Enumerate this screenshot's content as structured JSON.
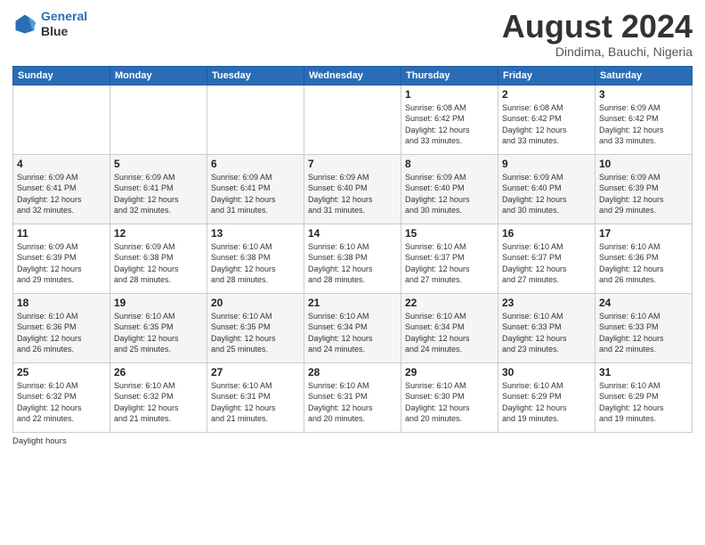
{
  "header": {
    "logo_line1": "General",
    "logo_line2": "Blue",
    "month_title": "August 2024",
    "location": "Dindima, Bauchi, Nigeria"
  },
  "days_of_week": [
    "Sunday",
    "Monday",
    "Tuesday",
    "Wednesday",
    "Thursday",
    "Friday",
    "Saturday"
  ],
  "weeks": [
    [
      {
        "day": "",
        "info": ""
      },
      {
        "day": "",
        "info": ""
      },
      {
        "day": "",
        "info": ""
      },
      {
        "day": "",
        "info": ""
      },
      {
        "day": "1",
        "info": "Sunrise: 6:08 AM\nSunset: 6:42 PM\nDaylight: 12 hours\nand 33 minutes."
      },
      {
        "day": "2",
        "info": "Sunrise: 6:08 AM\nSunset: 6:42 PM\nDaylight: 12 hours\nand 33 minutes."
      },
      {
        "day": "3",
        "info": "Sunrise: 6:09 AM\nSunset: 6:42 PM\nDaylight: 12 hours\nand 33 minutes."
      }
    ],
    [
      {
        "day": "4",
        "info": "Sunrise: 6:09 AM\nSunset: 6:41 PM\nDaylight: 12 hours\nand 32 minutes."
      },
      {
        "day": "5",
        "info": "Sunrise: 6:09 AM\nSunset: 6:41 PM\nDaylight: 12 hours\nand 32 minutes."
      },
      {
        "day": "6",
        "info": "Sunrise: 6:09 AM\nSunset: 6:41 PM\nDaylight: 12 hours\nand 31 minutes."
      },
      {
        "day": "7",
        "info": "Sunrise: 6:09 AM\nSunset: 6:40 PM\nDaylight: 12 hours\nand 31 minutes."
      },
      {
        "day": "8",
        "info": "Sunrise: 6:09 AM\nSunset: 6:40 PM\nDaylight: 12 hours\nand 30 minutes."
      },
      {
        "day": "9",
        "info": "Sunrise: 6:09 AM\nSunset: 6:40 PM\nDaylight: 12 hours\nand 30 minutes."
      },
      {
        "day": "10",
        "info": "Sunrise: 6:09 AM\nSunset: 6:39 PM\nDaylight: 12 hours\nand 29 minutes."
      }
    ],
    [
      {
        "day": "11",
        "info": "Sunrise: 6:09 AM\nSunset: 6:39 PM\nDaylight: 12 hours\nand 29 minutes."
      },
      {
        "day": "12",
        "info": "Sunrise: 6:09 AM\nSunset: 6:38 PM\nDaylight: 12 hours\nand 28 minutes."
      },
      {
        "day": "13",
        "info": "Sunrise: 6:10 AM\nSunset: 6:38 PM\nDaylight: 12 hours\nand 28 minutes."
      },
      {
        "day": "14",
        "info": "Sunrise: 6:10 AM\nSunset: 6:38 PM\nDaylight: 12 hours\nand 28 minutes."
      },
      {
        "day": "15",
        "info": "Sunrise: 6:10 AM\nSunset: 6:37 PM\nDaylight: 12 hours\nand 27 minutes."
      },
      {
        "day": "16",
        "info": "Sunrise: 6:10 AM\nSunset: 6:37 PM\nDaylight: 12 hours\nand 27 minutes."
      },
      {
        "day": "17",
        "info": "Sunrise: 6:10 AM\nSunset: 6:36 PM\nDaylight: 12 hours\nand 26 minutes."
      }
    ],
    [
      {
        "day": "18",
        "info": "Sunrise: 6:10 AM\nSunset: 6:36 PM\nDaylight: 12 hours\nand 26 minutes."
      },
      {
        "day": "19",
        "info": "Sunrise: 6:10 AM\nSunset: 6:35 PM\nDaylight: 12 hours\nand 25 minutes."
      },
      {
        "day": "20",
        "info": "Sunrise: 6:10 AM\nSunset: 6:35 PM\nDaylight: 12 hours\nand 25 minutes."
      },
      {
        "day": "21",
        "info": "Sunrise: 6:10 AM\nSunset: 6:34 PM\nDaylight: 12 hours\nand 24 minutes."
      },
      {
        "day": "22",
        "info": "Sunrise: 6:10 AM\nSunset: 6:34 PM\nDaylight: 12 hours\nand 24 minutes."
      },
      {
        "day": "23",
        "info": "Sunrise: 6:10 AM\nSunset: 6:33 PM\nDaylight: 12 hours\nand 23 minutes."
      },
      {
        "day": "24",
        "info": "Sunrise: 6:10 AM\nSunset: 6:33 PM\nDaylight: 12 hours\nand 22 minutes."
      }
    ],
    [
      {
        "day": "25",
        "info": "Sunrise: 6:10 AM\nSunset: 6:32 PM\nDaylight: 12 hours\nand 22 minutes."
      },
      {
        "day": "26",
        "info": "Sunrise: 6:10 AM\nSunset: 6:32 PM\nDaylight: 12 hours\nand 21 minutes."
      },
      {
        "day": "27",
        "info": "Sunrise: 6:10 AM\nSunset: 6:31 PM\nDaylight: 12 hours\nand 21 minutes."
      },
      {
        "day": "28",
        "info": "Sunrise: 6:10 AM\nSunset: 6:31 PM\nDaylight: 12 hours\nand 20 minutes."
      },
      {
        "day": "29",
        "info": "Sunrise: 6:10 AM\nSunset: 6:30 PM\nDaylight: 12 hours\nand 20 minutes."
      },
      {
        "day": "30",
        "info": "Sunrise: 6:10 AM\nSunset: 6:29 PM\nDaylight: 12 hours\nand 19 minutes."
      },
      {
        "day": "31",
        "info": "Sunrise: 6:10 AM\nSunset: 6:29 PM\nDaylight: 12 hours\nand 19 minutes."
      }
    ]
  ],
  "note": "Daylight hours"
}
